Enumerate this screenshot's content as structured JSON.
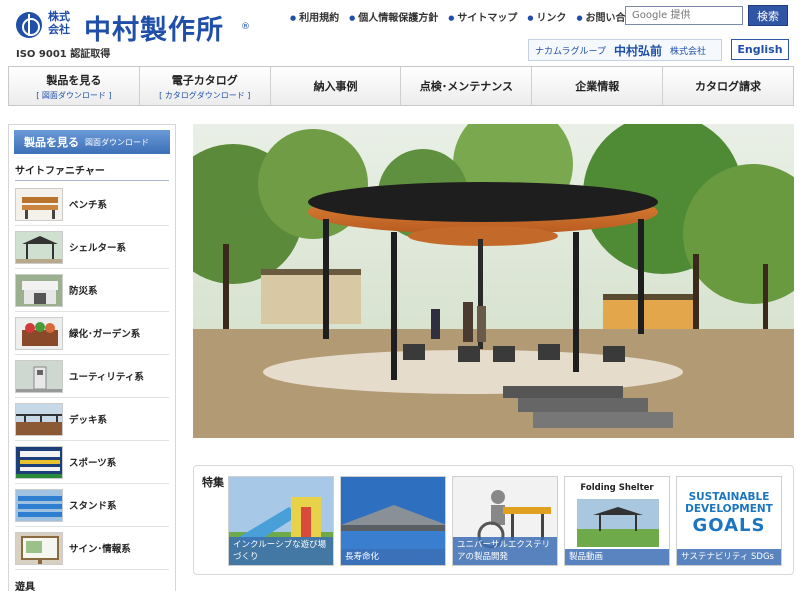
{
  "header": {
    "logo_sub": "株式会社",
    "logo_name": "中村製作所",
    "logo_reg": "®",
    "iso": "ISO 9001 認証取得",
    "util_links": [
      "利用規約",
      "個人情報保護方針",
      "サイトマップ",
      "リンク",
      "お問い合わせ"
    ],
    "search_placeholder": "Google 提供",
    "search_button": "検索",
    "group_label": "ナカムラグループ",
    "group_brand": "中村弘前",
    "group_brand_suffix": "株式会社",
    "english": "English"
  },
  "nav": [
    {
      "label": "製品を見る",
      "sub": "[ 図面ダウンロード ]"
    },
    {
      "label": "電子カタログ",
      "sub": "[ カタログダウンロード ]"
    },
    {
      "label": "納入事例",
      "sub": ""
    },
    {
      "label": "点検･メンテナンス",
      "sub": ""
    },
    {
      "label": "企業情報",
      "sub": ""
    },
    {
      "label": "カタログ請求",
      "sub": ""
    }
  ],
  "sidebar": {
    "banner_main": "製品を見る",
    "banner_sub": "図面ダウンロード",
    "heading": "サイトファニチャー",
    "categories": [
      "ベンチ系",
      "シェルター系",
      "防災系",
      "緑化･ガーデン系",
      "ユーティリティ系",
      "デッキ系",
      "スポーツ系",
      "スタンド系",
      "サイン･情報系"
    ],
    "bottom_heading": "遊具"
  },
  "features": {
    "title": "特集",
    "cards": [
      {
        "caption": "インクルーシブな遊び場づくり"
      },
      {
        "caption": "長寿命化"
      },
      {
        "caption": "ユニバーサルエクステリアの製品開発"
      },
      {
        "caption": "製品動画",
        "overlay": "Folding Shelter"
      },
      {
        "caption": "サステナビリティ SDGs",
        "overlay_top": "SUSTAINABLE DEVELOPMENT",
        "overlay_goals": "GOALS"
      }
    ]
  },
  "colors": {
    "brand": "#1f4fa8",
    "banner": "#3d6fb8"
  }
}
